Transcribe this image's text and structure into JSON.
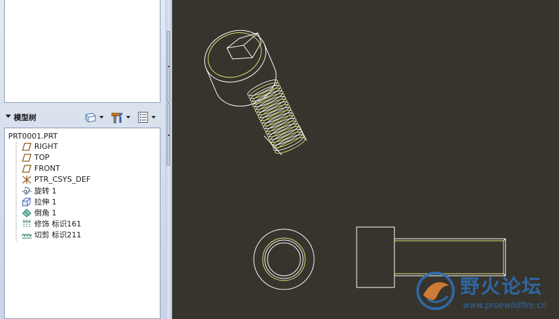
{
  "model_tree": {
    "header_label": "模型树",
    "root": "PRT0001.PRT",
    "items": [
      {
        "label": "RIGHT",
        "icon": "datum-plane-icon"
      },
      {
        "label": "TOP",
        "icon": "datum-plane-icon"
      },
      {
        "label": "FRONT",
        "icon": "datum-plane-icon"
      },
      {
        "label": "PTR_CSYS_DEF",
        "icon": "coordinate-system-icon"
      },
      {
        "label": "旋转 1",
        "icon": "revolve-icon"
      },
      {
        "label": "拉伸 1",
        "icon": "extrude-icon"
      },
      {
        "label": "倒角 1",
        "icon": "chamfer-icon"
      },
      {
        "label": "修饰 标识161",
        "icon": "cosmetic-thread-icon"
      },
      {
        "label": "切剪 标识211",
        "icon": "cut-icon"
      }
    ]
  },
  "toolbar_icons": [
    "show-icon",
    "settings-icon",
    "columns-icon"
  ],
  "watermark": {
    "title": "野火论坛",
    "url": "www.proewildfire.cn"
  },
  "colors": {
    "graphics_bg": "#36342d",
    "edge_white": "#ffffff",
    "edge_yellow": "#e8e47a",
    "panel_bg": "#d4dcea"
  }
}
